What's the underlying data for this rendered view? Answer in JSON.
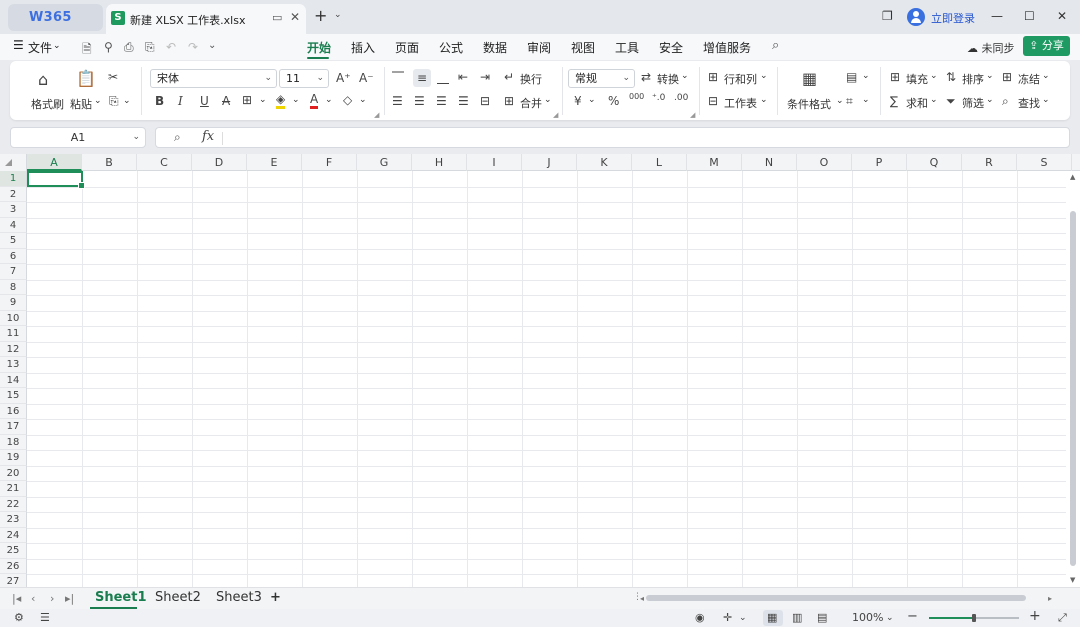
{
  "titlebar": {
    "app_logo": "W365",
    "tab_badge": "S",
    "tab_title": "新建 XLSX 工作表.xlsx",
    "login_label": "立即登录",
    "icons": [
      "monitor-icon",
      "close-icon",
      "plus-icon",
      "chevron-down-icon",
      "window-restore-icon",
      "user-icon",
      "minimize-icon",
      "maximize-icon",
      "close-icon"
    ]
  },
  "menubar": {
    "file_label": "文件",
    "tabs": [
      "开始",
      "插入",
      "页面",
      "公式",
      "数据",
      "审阅",
      "视图",
      "工具",
      "安全",
      "增值服务"
    ],
    "active_tab": "开始",
    "sync_label": "未同步",
    "share_label": "分享"
  },
  "ribbon": {
    "format_painter": "格式刷",
    "paste": "粘贴",
    "font_name": "宋体",
    "font_size": "11",
    "number_format": "常规",
    "wrap": "换行",
    "merge": "合并",
    "convert": "转换",
    "rows_cols": "行和列",
    "worksheet": "工作表",
    "cond_format": "条件格式",
    "fill": "填充",
    "sort": "排序",
    "freeze": "冻结",
    "sum": "求和",
    "filter": "筛选",
    "find": "查找",
    "bold": "B",
    "italic": "I",
    "underline": "U",
    "strike": "A",
    "font_color_glyph": "A",
    "currency": "¥",
    "percent": "%",
    "thousands": "000",
    "grow": "A⁺",
    "shrink": "A⁻"
  },
  "formula_bar": {
    "name_box": "A1",
    "fx": "fx",
    "content": ""
  },
  "grid": {
    "columns": [
      "A",
      "B",
      "C",
      "D",
      "E",
      "F",
      "G",
      "H",
      "I",
      "J",
      "K",
      "L",
      "M",
      "N",
      "O",
      "P",
      "Q",
      "R",
      "S"
    ],
    "rows": [
      "1",
      "2",
      "3",
      "4",
      "5",
      "6",
      "7",
      "8",
      "9",
      "10",
      "11",
      "12",
      "13",
      "14",
      "15",
      "16",
      "17",
      "18",
      "19",
      "20",
      "21",
      "22",
      "23",
      "24",
      "25",
      "26",
      "27"
    ],
    "active_cell": "A1"
  },
  "sheets": {
    "tabs": [
      "Sheet1",
      "Sheet2",
      "Sheet3"
    ],
    "active": "Sheet1",
    "add_label": "+"
  },
  "status": {
    "zoom": "100%",
    "zoom_level": 0.5,
    "minus": "−",
    "plus": "+"
  },
  "colors": {
    "accent": "#1a7d4f",
    "share": "#1e9a62",
    "logo": "#3d6fe0"
  }
}
